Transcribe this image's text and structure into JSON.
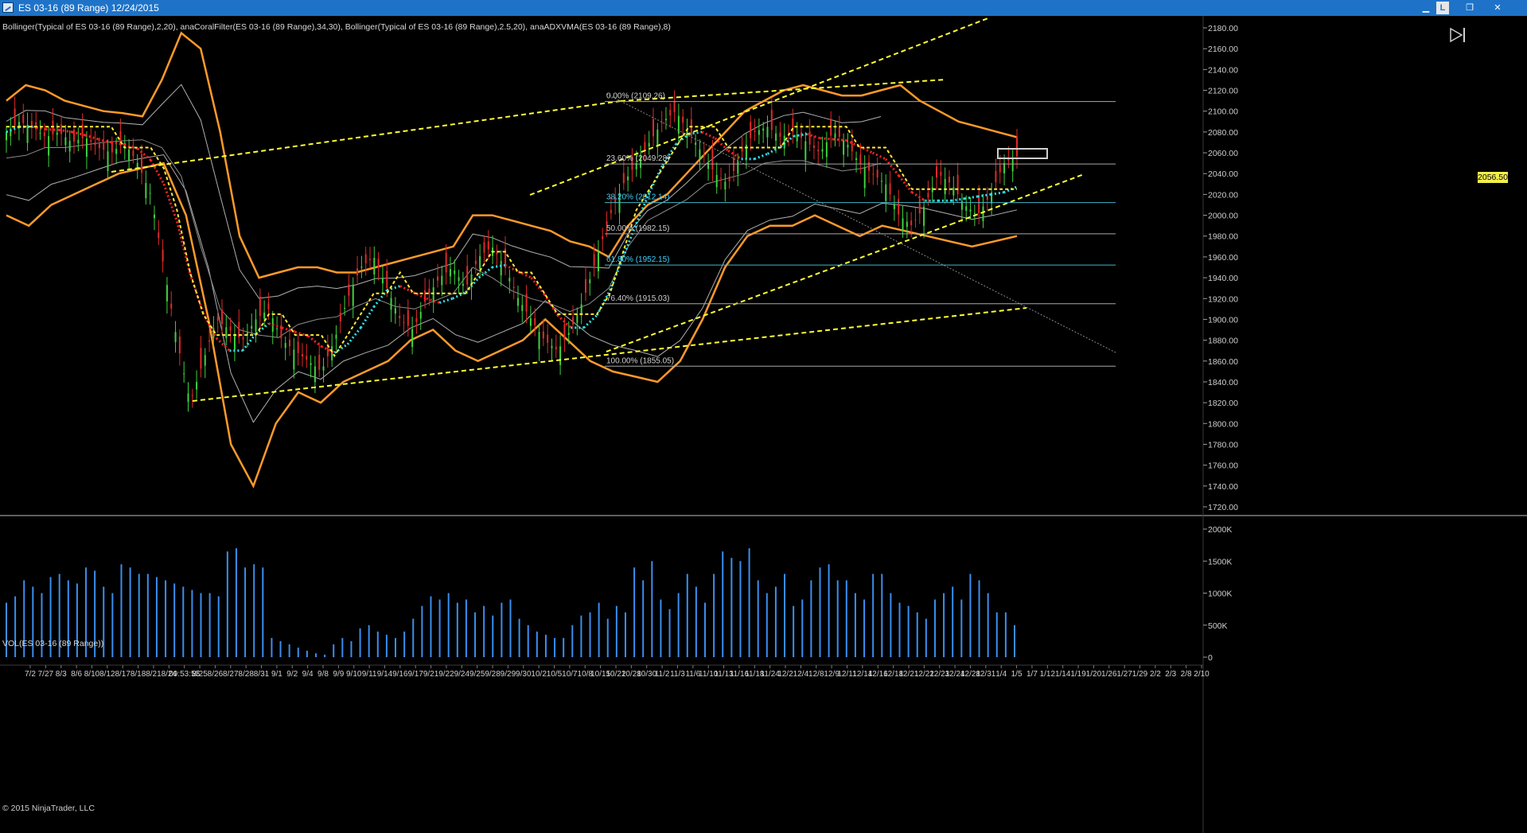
{
  "window": {
    "title": "ES 03-16 (89 Range)  12/24/2015",
    "buttons": {
      "minimize": "▁",
      "link": "L",
      "restore": "❐",
      "close": "✕"
    }
  },
  "price_panel": {
    "indicator_legend": "Bollinger(Typical of ES 03-16 (89 Range),2,20), anaCoralFilter(ES 03-16 (89 Range),34,30), Bollinger(Typical of ES 03-16 (89 Range),2.5,20), anaADXVMA(ES 03-16 (89 Range),8)",
    "last_price_label": "2056.50"
  },
  "volume_panel": {
    "legend": "VOL(ES 03-16 (89 Range))"
  },
  "copyright": "© 2015 NinjaTrader, LLC",
  "colors": {
    "background": "#000000",
    "up_bar": "#3fd23f",
    "down_bar": "#e02a2a",
    "outer_band": "#ff9a2a",
    "inner_band": "#b0b0b0",
    "trendline": "#ffff33",
    "coral_filter_up": "#2fe0e8",
    "coral_filter_down": "#ff2222",
    "volume_bar": "#3a8ef0",
    "fib_line": "#a8a8a8",
    "fib_text_cyan": "#3fd0ff",
    "last_price_bg": "#f2ee4b"
  },
  "chart_data": [
    {
      "type": "line",
      "title": "ES 03-16 (89 Range)",
      "y_axis": {
        "min": 1710,
        "max": 2190,
        "ticks": [
          2180,
          2160,
          2140,
          2120,
          2100,
          2080,
          2060,
          2040,
          2020,
          2000,
          1980,
          1960,
          1940,
          1920,
          1900,
          1880,
          1860,
          1840,
          1820,
          1800,
          1780,
          1760,
          1740,
          1720
        ],
        "tick_labels": [
          "2180.00",
          "2160.00",
          "2140.00",
          "2120.00",
          "2100.00",
          "2080.00",
          "2060.00",
          "2040.00",
          "2020.00",
          "2000.00",
          "1980.00",
          "1960.00",
          "1940.00",
          "1920.00",
          "1900.00",
          "1880.00",
          "1860.00",
          "1840.00",
          "1820.00",
          "1800.00",
          "1780.00",
          "1760.00",
          "1740.00",
          "1720.00"
        ]
      },
      "x_tick_labels": [
        "7/2",
        "7/27",
        "8/3",
        "8/6",
        "8/10",
        "8/12",
        "8/17",
        "8/18",
        "8/21",
        "8/24",
        "09:53:55",
        "8/25",
        "8/26",
        "8/27",
        "8/28",
        "8/31",
        "9/1",
        "9/2",
        "9/4",
        "9/8",
        "9/9",
        "9/10",
        "9/11",
        "9/14",
        "9/16",
        "9/17",
        "9/21",
        "9/22",
        "9/24",
        "9/25",
        "9/28",
        "9/29",
        "9/30",
        "10/2",
        "10/5",
        "10/7",
        "10/8",
        "10/15",
        "10/22",
        "10/28",
        "10/30",
        "11/2",
        "11/3",
        "11/6",
        "11/10",
        "11/13",
        "11/16",
        "11/18",
        "11/24",
        "12/2",
        "12/4",
        "12/8",
        "12/9",
        "12/11",
        "12/14",
        "12/16",
        "12/18",
        "12/21",
        "12/22",
        "12/23",
        "12/24",
        "12/28",
        "12/31",
        "1/4",
        "1/5",
        "1/7",
        "1/12",
        "1/14",
        "1/19",
        "1/20",
        "1/26",
        "1/27",
        "1/29",
        "2/2",
        "2/3",
        "2/8",
        "2/10"
      ],
      "series": [
        {
          "name": "Close",
          "values": [
            2080,
            2090,
            2085,
            2075,
            2080,
            2070,
            2075,
            2065,
            2060,
            2070,
            2050,
            2020,
            1950,
            1880,
            1820,
            1860,
            1900,
            1890,
            1880,
            1900,
            1910,
            1880,
            1870,
            1860,
            1850,
            1880,
            1920,
            1950,
            1960,
            1930,
            1900,
            1890,
            1920,
            1940,
            1950,
            1930,
            1960,
            1970,
            1950,
            1920,
            1900,
            1880,
            1870,
            1890,
            1920,
            1960,
            2000,
            2030,
            2050,
            2070,
            2090,
            2100,
            2080,
            2060,
            2040,
            2030,
            2060,
            2080,
            2085,
            2075,
            2080,
            2070,
            2060,
            2080,
            2070,
            2050,
            2040,
            2030,
            2000,
            1990,
            2010,
            2040,
            2030,
            2010,
            2000,
            2020,
            2050,
            2056.5
          ]
        },
        {
          "name": "Bollinger 2.5 Upper",
          "values": [
            2110,
            2125,
            2120,
            2110,
            2105,
            2100,
            2098,
            2095,
            2130,
            2175,
            2160,
            2080,
            1980,
            1940,
            1945,
            1950,
            1950,
            1945,
            1945,
            1950,
            1955,
            1960,
            1965,
            1970,
            2000,
            2000,
            1995,
            1990,
            1985,
            1975,
            1970,
            1960,
            1990,
            2010,
            2020,
            2040,
            2060,
            2080,
            2100,
            2110,
            2120,
            2125,
            2120,
            2115,
            2115,
            2120,
            2125,
            2110,
            2100,
            2090,
            2085,
            2080,
            2075
          ]
        },
        {
          "name": "Bollinger 2.5 Lower",
          "values": [
            2000,
            1990,
            2010,
            2020,
            2030,
            2040,
            2045,
            2050,
            2000,
            1900,
            1780,
            1740,
            1800,
            1830,
            1820,
            1840,
            1850,
            1860,
            1880,
            1890,
            1870,
            1860,
            1870,
            1880,
            1900,
            1880,
            1860,
            1850,
            1845,
            1840,
            1860,
            1900,
            1950,
            1980,
            1990,
            1990,
            2000,
            1990,
            1980,
            1990,
            1985,
            1980,
            1975,
            1970,
            1975,
            1980
          ]
        }
      ]
    },
    {
      "type": "bar",
      "title": "VOL(ES 03-16 (89 Range))",
      "y_axis": {
        "min": 0,
        "max": 2000000,
        "tick_labels": [
          "2000K",
          "1500K",
          "1000K",
          "500K",
          "0"
        ]
      },
      "approx_volume_k": [
        850,
        950,
        1200,
        1100,
        1000,
        1250,
        1300,
        1200,
        1150,
        1400,
        1350,
        1100,
        1000,
        1450,
        1400,
        1300,
        1300,
        1250,
        1200,
        1150,
        1100,
        1050,
        1000,
        1000,
        950,
        1650,
        1700,
        1400,
        1450,
        1400,
        300,
        250,
        200,
        150,
        100,
        60,
        40,
        200,
        300,
        250,
        450,
        500,
        400,
        350,
        300,
        400,
        600,
        800,
        950,
        900,
        1000,
        850,
        900,
        700,
        800,
        650,
        850,
        900,
        600,
        500,
        400,
        350,
        300,
        300,
        500,
        650,
        700,
        850,
        600,
        800,
        700,
        1400,
        1200,
        1500,
        900,
        750,
        1000,
        1300,
        1100,
        850,
        1300,
        1650,
        1550,
        1500,
        1700,
        1200,
        1000,
        1100,
        1300,
        800,
        900,
        1200,
        1400,
        1450,
        1200,
        1200,
        1000,
        900,
        1300,
        1300,
        1000,
        850,
        800,
        700,
        600,
        900,
        1000,
        1100,
        900,
        1300,
        1200,
        1000,
        700,
        700,
        500
      ]
    }
  ],
  "fibonacci": [
    {
      "label": "0.00% (2109.26)",
      "price": 2109.26
    },
    {
      "label": "23.60% (2049.28)",
      "price": 2049.28
    },
    {
      "label": "38.20% (2012.14)",
      "price": 2012.14
    },
    {
      "label": "50.00% (1982.15)",
      "price": 1982.15
    },
    {
      "label": "61.80% (1952.15)",
      "price": 1952.15
    },
    {
      "label": "76.40% (1915.03)",
      "price": 1915.03
    },
    {
      "label": "100.00% (1855.05)",
      "price": 1855.05
    }
  ]
}
